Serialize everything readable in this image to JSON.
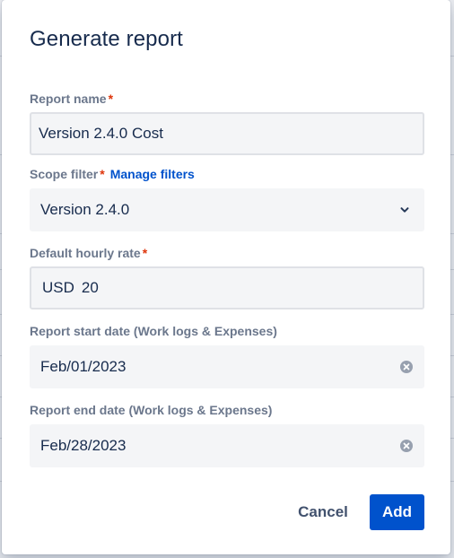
{
  "dialog": {
    "title": "Generate report"
  },
  "report_name": {
    "label": "Report name",
    "required_mark": "*",
    "value": "Version 2.4.0 Cost"
  },
  "scope_filter": {
    "label": "Scope filter",
    "required_mark": "*",
    "link": "Manage filters",
    "selected": "Version 2.4.0",
    "icon": "chevron-down-icon"
  },
  "hourly_rate": {
    "label": "Default hourly rate",
    "required_mark": "*",
    "currency": "USD",
    "value": "20"
  },
  "start_date": {
    "label": "Report start date (Work logs & Expenses)",
    "value": "Feb/01/2023",
    "icon": "clear-icon"
  },
  "end_date": {
    "label": "Report end date (Work logs & Expenses)",
    "value": "Feb/28/2023",
    "icon": "clear-icon"
  },
  "actions": {
    "cancel": "Cancel",
    "add": "Add"
  },
  "colors": {
    "primary": "#0052cc",
    "heading": "#172b4d",
    "label": "#6b778c",
    "required": "#de350b"
  }
}
